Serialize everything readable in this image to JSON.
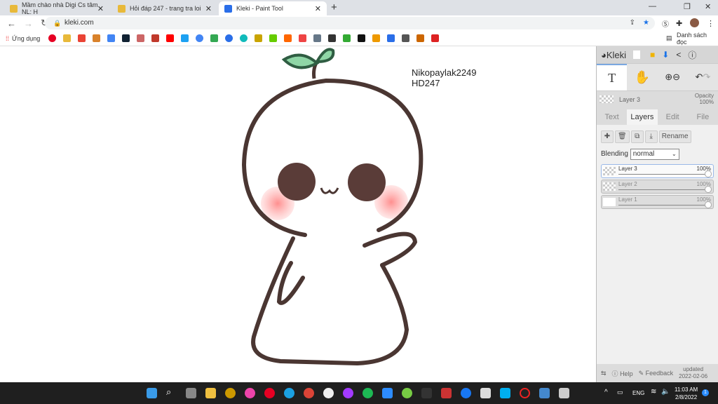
{
  "tabs": [
    {
      "title": "Mầm chào nhà Digi Cs tâm NL: H",
      "active": false
    },
    {
      "title": "Hỏi đáp 247 - trang tra loi",
      "active": false
    },
    {
      "title": "Kleki - Paint Tool",
      "active": true
    }
  ],
  "url": "kleki.com",
  "bookmarks": {
    "apps": "Ứng dụng",
    "reading_list": "Danh sách đọc"
  },
  "canvas_text": {
    "line1": "Nikopaylak2249",
    "line2": "HD247"
  },
  "kleki": {
    "logo": "Kleki",
    "current_layer": "Layer 3",
    "opacity_label": "Opacity",
    "opacity_value": "100%",
    "tabs": [
      "Text",
      "Layers",
      "Edit",
      "File"
    ],
    "active_tab": "Layers",
    "rename": "Rename",
    "blending_label": "Blending",
    "blending_value": "normal",
    "layers": [
      {
        "name": "Layer 3",
        "opacity": "100%",
        "selected": true
      },
      {
        "name": "Layer 2",
        "opacity": "100%",
        "selected": false
      },
      {
        "name": "Layer 1",
        "opacity": "100%",
        "selected": false
      }
    ],
    "help": "Help",
    "feedback": "Feedback",
    "updated_label": "updated",
    "updated_date": "2022-02-06"
  },
  "taskbar": {
    "lang": "ENG",
    "time": "11:03 AM",
    "date": "2/8/2022",
    "notifications": "1"
  }
}
